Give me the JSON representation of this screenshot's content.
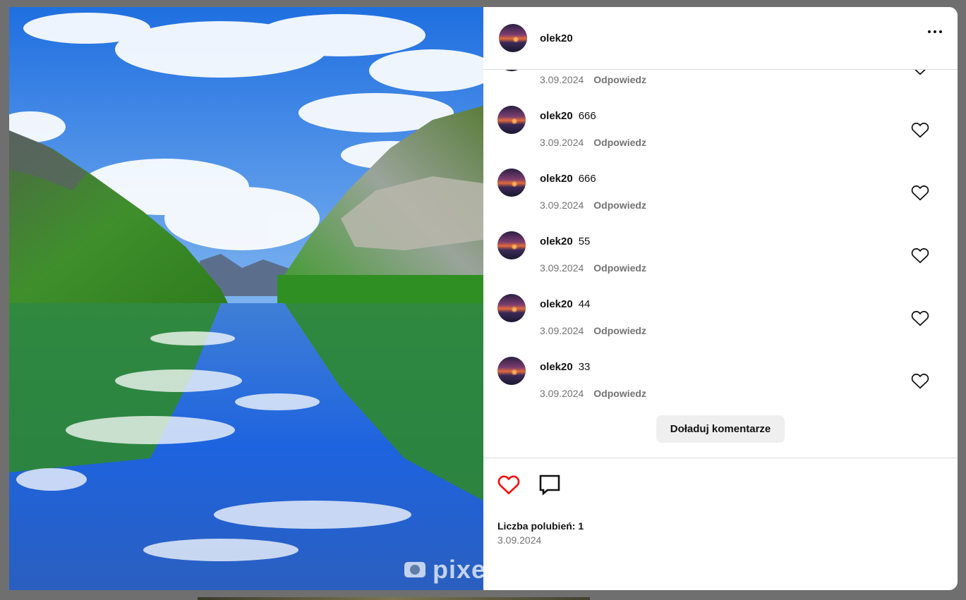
{
  "post": {
    "author": "olek20",
    "likes_text": "Liczba polubień: 1",
    "date": "3.09.2024",
    "liked": true
  },
  "photo": {
    "watermark": "pixe"
  },
  "comments": [
    {
      "author": "",
      "text": "",
      "date": "3.09.2024",
      "reply_label": "Odpowiedz"
    },
    {
      "author": "olek20",
      "text": "666",
      "date": "3.09.2024",
      "reply_label": "Odpowiedz"
    },
    {
      "author": "olek20",
      "text": "666",
      "date": "3.09.2024",
      "reply_label": "Odpowiedz"
    },
    {
      "author": "olek20",
      "text": "55",
      "date": "3.09.2024",
      "reply_label": "Odpowiedz"
    },
    {
      "author": "olek20",
      "text": "44",
      "date": "3.09.2024",
      "reply_label": "Odpowiedz"
    },
    {
      "author": "olek20",
      "text": "33",
      "date": "3.09.2024",
      "reply_label": "Odpowiedz"
    }
  ],
  "load_more_label": "Doładuj komentarze",
  "icons": {
    "more": "more-options-icon",
    "like": "heart-icon",
    "comment": "comment-icon"
  },
  "colors": {
    "like_active": "#ff0000",
    "muted_text": "#737373",
    "button_bg": "#efefef"
  }
}
